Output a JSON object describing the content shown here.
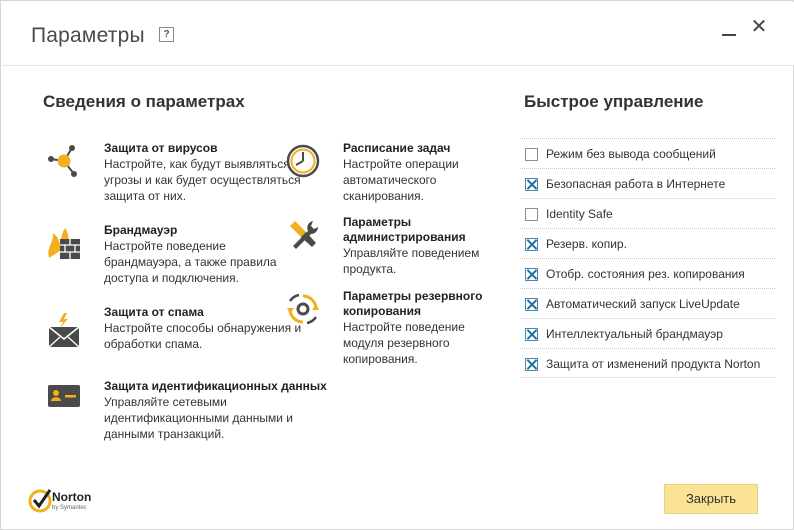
{
  "window": {
    "title": "Параметры",
    "help_label": "?",
    "close_glyph": "✕"
  },
  "settings_section": {
    "title": "Сведения о параметрах",
    "items": [
      {
        "name": "Защита от вирусов",
        "desc": "Настройте, как будут выявляться угрозы и как будет осуществляться защита от них.",
        "icon": "virus-icon"
      },
      {
        "name": "Брандмауэр",
        "desc": "Настройте поведение брандмауэра, а также правила доступа и подключения.",
        "icon": "firewall-icon"
      },
      {
        "name": "Защита от спама",
        "desc": "Настройте способы обнаружения и обработки спама.",
        "icon": "spam-mail-icon"
      },
      {
        "name": "Защита идентификационных данных",
        "desc": "Управляйте сетевыми идентификационными данными и данными транзакций.",
        "icon": "identity-card-icon"
      },
      {
        "name": "Расписание задач",
        "desc": "Настройте операции автоматического сканирования.",
        "icon": "clock-icon"
      },
      {
        "name": "Параметры администрирования",
        "desc": "Управляйте поведением продукта.",
        "icon": "tools-icon"
      },
      {
        "name": "Параметры резервного копирования",
        "desc": "Настройте поведение модуля резервного копирования.",
        "icon": "backup-sync-icon"
      }
    ]
  },
  "quick_control": {
    "title": "Быстрое управление",
    "items": [
      {
        "label": "Режим без вывода сообщений",
        "checked": false
      },
      {
        "label": "Безопасная работа в Интернете",
        "checked": true
      },
      {
        "label": "Identity Safe",
        "checked": false
      },
      {
        "label": "Резерв. копир.",
        "checked": true
      },
      {
        "label": "Отобр. состояния рез. копирования",
        "checked": true
      },
      {
        "label": "Автоматический запуск LiveUpdate",
        "checked": true
      },
      {
        "label": "Интеллектуальный брандмауэр",
        "checked": true
      },
      {
        "label": "Защита от изменений продукта Norton",
        "checked": true
      }
    ]
  },
  "footer": {
    "logo_text": "Norton",
    "logo_subtext": "by Symantec",
    "close_button_label": "Закрыть"
  },
  "colors": {
    "accent_yellow": "#fae394",
    "icon_gold": "#f2b01e",
    "icon_dark": "#4a4a4a",
    "check_blue": "#1f6fa3"
  }
}
